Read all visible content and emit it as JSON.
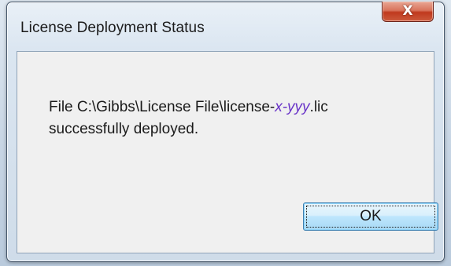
{
  "window": {
    "title": "License Deployment Status"
  },
  "titlebar": {
    "close_glyph": "X",
    "close_icon": "close-icon"
  },
  "message": {
    "line1_prefix": "File C:\\Gibbs\\License File\\license-",
    "var_x": "x",
    "dash": "-",
    "var_yyy": "yyy",
    "line1_suffix": ".lic",
    "line2": "successfully deployed."
  },
  "buttons": {
    "ok_label": "OK"
  },
  "colors": {
    "placeholder_text": "#6a35c8",
    "close_button": "#c0391e",
    "ok_button_border": "#3c7fb1"
  }
}
